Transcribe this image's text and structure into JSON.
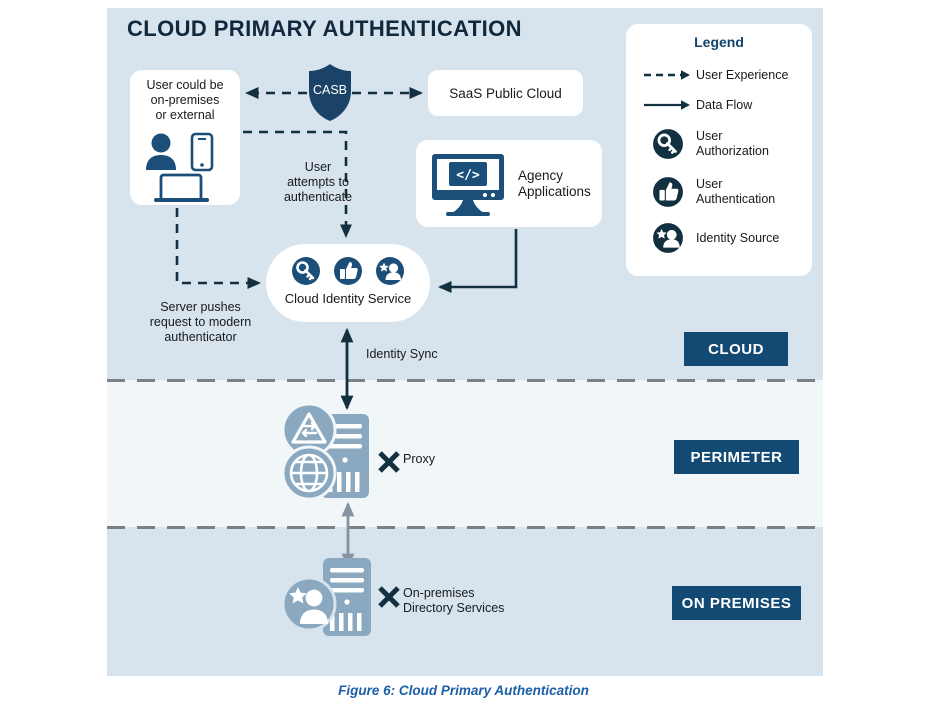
{
  "diagram": {
    "title": "CLOUD PRIMARY AUTHENTICATION",
    "caption": "Figure 6: Cloud Primary Authentication"
  },
  "colors": {
    "dark_navy": "#12303f",
    "badge_blue": "#134a73",
    "icon_navy": "#1b4f79",
    "muted_steel": "#8aa8bf",
    "zone_cloud_bg": "#d7e3ed",
    "zone_perimeter_bg": "#f1f6f9",
    "zone_onprem_bg": "#d7e3ed",
    "divider_gray": "#7d7f82",
    "caption_blue": "#1d5fa8",
    "legend_title_blue": "#12446f"
  },
  "nodes": {
    "user": {
      "label": "User could be\non-premises\nor external",
      "label_lines": [
        "User could be",
        "on-premises",
        "or external"
      ],
      "icons": [
        "person-icon",
        "mobile-phone-icon",
        "laptop-icon"
      ]
    },
    "casb": {
      "label": "CASB",
      "icon": "shield-icon"
    },
    "saas": {
      "label": "SaaS Public Cloud"
    },
    "agency": {
      "label": "Agency\nApplications",
      "label_lines": [
        "Agency",
        "Applications"
      ],
      "icon": "monitor-code-icon"
    },
    "cloud_identity_service": {
      "label": "Cloud Identity Service",
      "icons": [
        "user-authorization-key-icon",
        "user-authentication-thumbsup-icon",
        "identity-source-icon"
      ]
    },
    "proxy": {
      "label": "Proxy",
      "marked": "x",
      "icon": "proxy-server-icon"
    },
    "on_prem_directory": {
      "label": "On-premises\nDirectory Services",
      "label_lines": [
        "On-premises",
        "Directory Services"
      ],
      "marked": "x",
      "icon": "directory-server-icon"
    }
  },
  "connector_labels": {
    "user_attempts": "User\nattempts to\nauthenticate",
    "user_attempts_lines": [
      "User",
      "attempts to",
      "authenticate"
    ],
    "server_pushes": "Server pushes\nrequest to modern\nauthenticator",
    "server_pushes_lines": [
      "Server pushes",
      "request to modern",
      "authenticator"
    ],
    "identity_sync": "Identity Sync"
  },
  "legend": {
    "title": "Legend",
    "items": [
      {
        "label": "User Experience",
        "icon": "dashed-arrow-icon"
      },
      {
        "label": "Data Flow",
        "icon": "solid-arrow-icon"
      },
      {
        "label": "User\nAuthorization",
        "label_lines": [
          "User",
          "Authorization"
        ],
        "icon": "key-circle-icon"
      },
      {
        "label": "User\nAuthentication",
        "label_lines": [
          "User",
          "Authentication"
        ],
        "icon": "thumbsup-circle-icon"
      },
      {
        "label": "Identity Source",
        "icon": "identity-source-circle-icon"
      }
    ]
  },
  "zones": [
    {
      "name": "cloud",
      "label": "CLOUD"
    },
    {
      "name": "perimeter",
      "label": "PERIMETER"
    },
    {
      "name": "on_premises",
      "label": "ON PREMISES"
    }
  ]
}
